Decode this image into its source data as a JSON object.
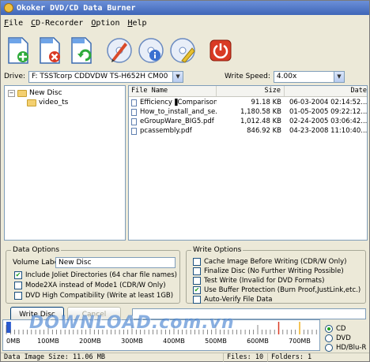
{
  "title": "Okoker DVD/CD Data Burner",
  "menu": [
    "File",
    "CD-Recorder",
    "Option",
    "Help"
  ],
  "toolbar": {
    "icons": [
      "add-file-icon",
      "remove-file-icon",
      "refresh-icon",
      "burn-disc-icon",
      "disc-info-icon",
      "erase-disc-icon",
      "exit-icon"
    ]
  },
  "drive": {
    "label": "Drive:",
    "value": "F: TSSTcorp CDDVDW TS-H652H CM00",
    "speed_label": "Write Speed:",
    "speed_value": "4.00x"
  },
  "tree": {
    "root": "New Disc",
    "child": "video_ts"
  },
  "filelist": {
    "columns": [
      "File Name",
      "Size",
      "Date"
    ],
    "rows": [
      {
        "name": "Efficiency▐Comparison...",
        "size": "91.18 KB",
        "date": "06-03-2004 02:14:52..."
      },
      {
        "name": "How_to_install_and_se...",
        "size": "1,180.58 KB",
        "date": "01-05-2005 09:22:12..."
      },
      {
        "name": "eGroupWare_BIG5.pdf",
        "size": "1,012.48 KB",
        "date": "02-24-2005 03:06:42..."
      },
      {
        "name": "pcassembly.pdf",
        "size": "846.92 KB",
        "date": "04-23-2008 11:10:40..."
      }
    ]
  },
  "data_options": {
    "legend": "Data Options",
    "volume_label": "Volume Label:",
    "volume_value": "New Disc",
    "options": [
      {
        "label": "Include Joliet Directories (64 char file names)",
        "checked": true
      },
      {
        "label": "Mode2XA instead of Mode1 (CDR/W Only)",
        "checked": false
      },
      {
        "label": "DVD High Compatibility (Write at least 1GB)",
        "checked": false
      }
    ]
  },
  "write_options": {
    "legend": "Write Options",
    "options": [
      {
        "label": "Cache Image Before Writing (CDR/W Only)",
        "checked": false
      },
      {
        "label": "Finalize Disc (No Further Writing Possible)",
        "checked": false
      },
      {
        "label": "Test Write (Invalid for DVD Formats)",
        "checked": false
      },
      {
        "label": "Use Buffer Protection (Burn Proof,JustLink,etc.)",
        "checked": true
      },
      {
        "label": "Auto-Verify File Data",
        "checked": false
      }
    ]
  },
  "buttons": {
    "write": "Write Disc",
    "cancel": "Cancel"
  },
  "capacity": {
    "ticks": [
      "0MB",
      "100MB",
      "200MB",
      "300MB",
      "400MB",
      "500MB",
      "600MB",
      "700MB"
    ],
    "used_mb": 11.06
  },
  "watermark": "DOWNLOAD.com.vn",
  "media": [
    {
      "label": "CD",
      "selected": true
    },
    {
      "label": "DVD",
      "selected": false
    },
    {
      "label": "HD/Blu-R",
      "selected": false
    }
  ],
  "status": {
    "image_size": "Data Image Size: 11.06 MB",
    "files": "Files: 10",
    "folders": "Folders: 1"
  },
  "colors": {
    "title_bar": "#3f66b8",
    "window_bg": "#ece9d8",
    "check_mark": "#21a121",
    "exit_red": "#d93a24"
  }
}
